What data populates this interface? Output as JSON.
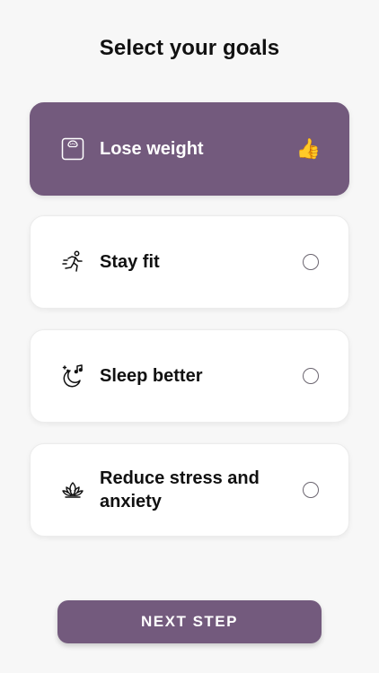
{
  "header": {
    "title": "Select your goals"
  },
  "goals": [
    {
      "label": "Lose weight",
      "icon": "scale-icon",
      "selected": true,
      "indicator": "👍"
    },
    {
      "label": "Stay fit",
      "icon": "running-person-icon",
      "selected": false
    },
    {
      "label": "Sleep better",
      "icon": "moon-music-icon",
      "selected": false
    },
    {
      "label": "Reduce stress and anxiety",
      "icon": "lotus-icon",
      "selected": false
    }
  ],
  "footer": {
    "next_label": "NEXT STEP"
  },
  "colors": {
    "accent": "#735a7d",
    "background": "#f7f7f7",
    "card": "#ffffff",
    "text": "#111111"
  }
}
